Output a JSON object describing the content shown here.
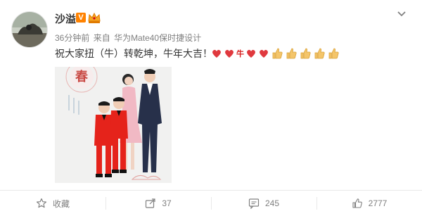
{
  "post": {
    "username": "沙溢",
    "verified_badge": "V",
    "time": "36分钟前",
    "source_prefix": "来自",
    "device": "华为Mate40保时捷设计",
    "text": "祝大家扭（牛）转乾坤，牛年大吉！",
    "niu_glyph": "牛",
    "emoji": [
      "heart",
      "heart",
      "niu",
      "heart",
      "heart",
      "thumbs-up",
      "thumbs-up",
      "thumbs-up",
      "thumbs-up",
      "thumbs-up"
    ]
  },
  "photo": {
    "banner_char": "春"
  },
  "actions": {
    "favorite_label": "收藏",
    "repost_count": "37",
    "comment_count": "245",
    "like_count": "2777"
  },
  "colors": {
    "accent_orange": "#ff8200",
    "text_primary": "#333333",
    "text_secondary": "#808080",
    "heart_red": "#e0393e",
    "thumb_yellow": "#f4c56a"
  },
  "icons": [
    "avatar-image",
    "verified-icon",
    "crown-icon",
    "chevron-down-icon",
    "heart-emoji",
    "thumbs-up-emoji",
    "star-icon",
    "repost-icon",
    "comment-icon",
    "like-icon"
  ]
}
